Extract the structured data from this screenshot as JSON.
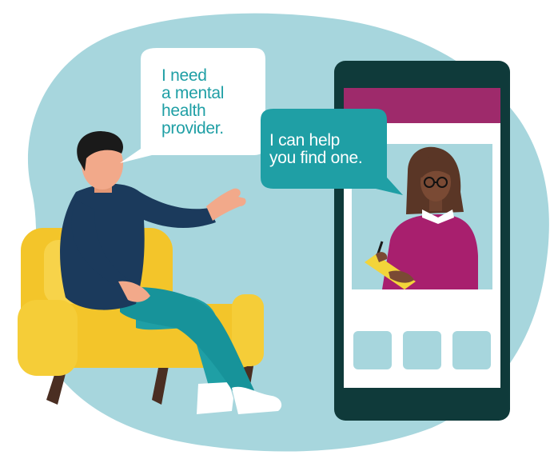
{
  "user_bubble": {
    "lines": [
      "I need",
      "a mental",
      "health",
      "provider."
    ]
  },
  "assistant_bubble": {
    "lines": [
      "I can help",
      "you find one."
    ]
  },
  "colors": {
    "blob": "#a7d6dd",
    "phone_frame": "#0f3a3a",
    "phone_header": "#9e2a6b",
    "screen_bg": "#ffffff",
    "video_bg": "#a7d6dd",
    "tile": "#a7d6dd",
    "assistant_bubble": "#1f9fa5",
    "user_bubble": "#ffffff",
    "user_text": "#1f9fa5",
    "chair": "#f3c52a",
    "sweater": "#1b3a5c",
    "pants": "#1f9fa5",
    "skin": "#f2a98a",
    "counselor_sweater": "#a81f6e",
    "clipboard": "#f3d43a"
  },
  "icons": [
    "video-call-counselor-illustration",
    "seated-man-illustration"
  ]
}
